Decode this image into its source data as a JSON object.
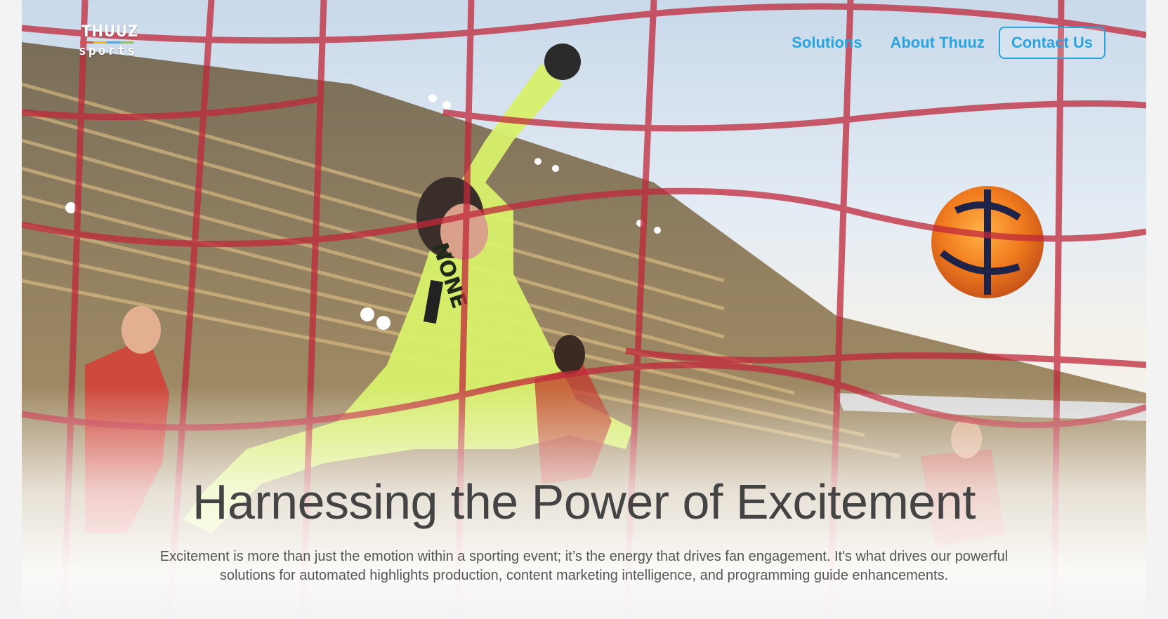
{
  "brand": {
    "logo_top": "THUUZ",
    "logo_bottom": "sports",
    "stripe_colors": [
      "#e94e3b",
      "#f2b705",
      "#3fa9f5",
      "#8dc63f"
    ]
  },
  "nav": {
    "items": [
      {
        "label": "Solutions"
      },
      {
        "label": "About Thuuz"
      }
    ],
    "contact_label": "Contact Us",
    "link_color": "#2aa4dc"
  },
  "hero": {
    "headline": "Harnessing the Power of Excitement",
    "subtext": "Excitement is more than just the emotion within a sporting event; it’s the energy that drives fan engagement. It's what drives our powerful solutions for automated highlights production, content marketing intelligence, and programming guide enhancements.",
    "jersey_text": "NONE"
  }
}
